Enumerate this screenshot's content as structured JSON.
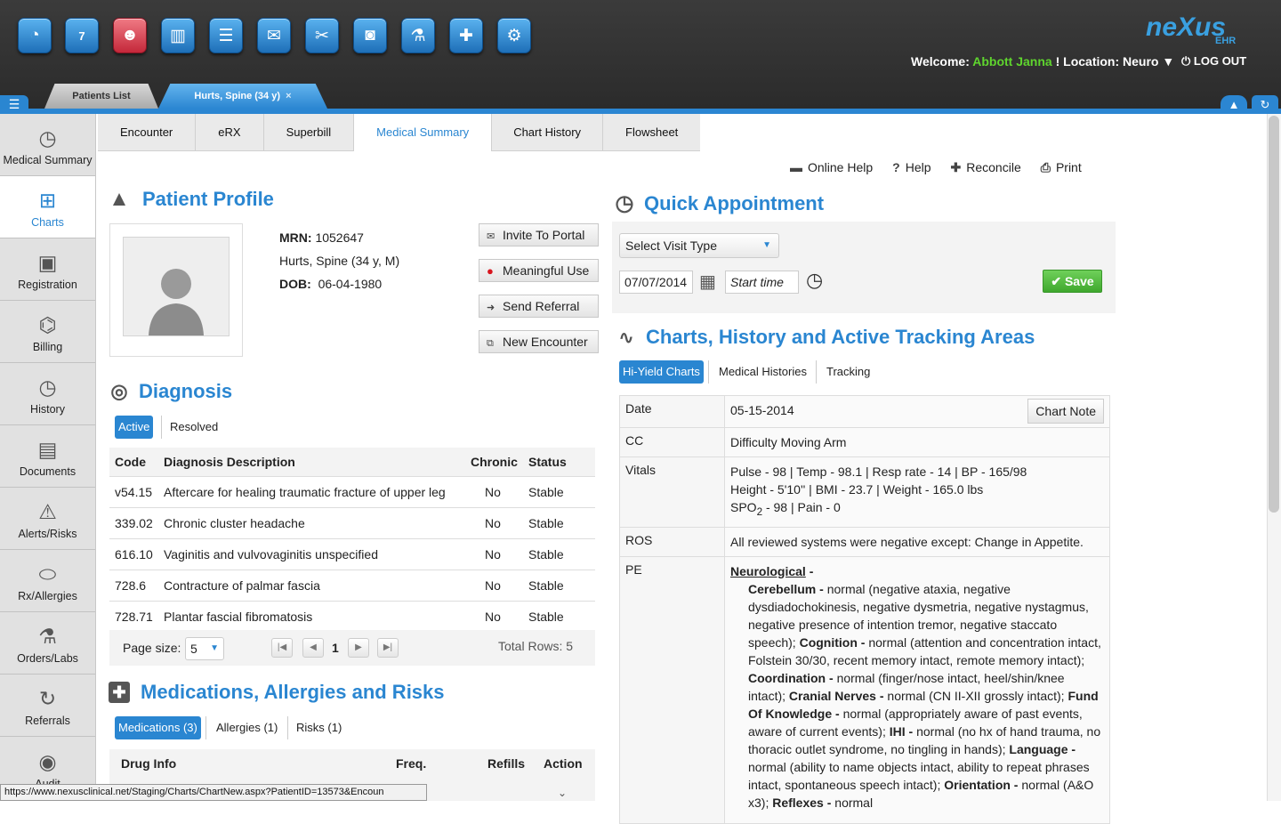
{
  "top_icons": [
    "dashboard-icon",
    "calendar-icon",
    "patients-icon",
    "reports-icon",
    "notes-icon",
    "mail-icon",
    "tools-icon",
    "camera-icon",
    "lab-flask-icon",
    "bandage-icon",
    "settings-icon"
  ],
  "calendar_day": "7",
  "logo": {
    "text1": "neXus",
    "text2": "EHR"
  },
  "header": {
    "welcome_label": "Welcome:",
    "user_name": "Abbott Janna",
    "location_label": "! Location: Neuro",
    "logout": "LOG OUT"
  },
  "patient_tabs": {
    "list": "Patients List",
    "active": "Hurts, Spine (34 y)",
    "close": "×"
  },
  "sidebar": [
    {
      "label": "Medical Summary",
      "icon": "clock-icon"
    },
    {
      "label": "Charts",
      "icon": "medkit-icon"
    },
    {
      "label": "Registration",
      "icon": "id-card-icon"
    },
    {
      "label": "Billing",
      "icon": "tag-icon"
    },
    {
      "label": "History",
      "icon": "clock-icon"
    },
    {
      "label": "Documents",
      "icon": "cabinet-icon"
    },
    {
      "label": "Alerts/Risks",
      "icon": "warning-icon"
    },
    {
      "label": "Rx/Allergies",
      "icon": "pill-icon"
    },
    {
      "label": "Orders/Labs",
      "icon": "flask-icon"
    },
    {
      "label": "Referrals",
      "icon": "refresh-icon"
    },
    {
      "label": "Audit",
      "icon": "eye-icon"
    }
  ],
  "nav_tabs": [
    "Encounter",
    "eRX",
    "Superbill",
    "Medical Summary",
    "Chart History",
    "Flowsheet"
  ],
  "toolbar": {
    "online_help": "Online Help",
    "help": "Help",
    "reconcile": "Reconcile",
    "print": "Print"
  },
  "profile": {
    "title": "Patient Profile",
    "mrn_label": "MRN:",
    "mrn": "1052647",
    "name": "Hurts, Spine (34 y, M)",
    "dob_label": "DOB:",
    "dob": "06-04-1980"
  },
  "actions": [
    "Invite To Portal",
    "Meaningful Use",
    "Send Referral",
    "New Encounter"
  ],
  "diagnosis": {
    "title": "Diagnosis",
    "tab_active": "Active",
    "tab_resolved": "Resolved",
    "headers": [
      "Code",
      "Diagnosis Description",
      "Chronic",
      "Status"
    ],
    "rows": [
      [
        "v54.15",
        "Aftercare for healing traumatic fracture of upper leg",
        "No",
        "Stable"
      ],
      [
        "339.02",
        "Chronic cluster headache",
        "No",
        "Stable"
      ],
      [
        "616.10",
        "Vaginitis and vulvovaginitis unspecified",
        "No",
        "Stable"
      ],
      [
        "728.6",
        "Contracture of palmar fascia",
        "No",
        "Stable"
      ],
      [
        "728.71",
        "Plantar fascial fibromatosis",
        "No",
        "Stable"
      ]
    ],
    "page_size_label": "Page size:",
    "page_size": "5",
    "page": "1",
    "total_rows": "Total Rows: 5"
  },
  "meds": {
    "title": "Medications, Allergies and Risks",
    "tabs": [
      "Medications (3)",
      "Allergies (1)",
      "Risks (1)"
    ],
    "headers": [
      "Drug Info",
      "Freq.",
      "Refills",
      "Action"
    ]
  },
  "appt": {
    "title": "Quick Appointment",
    "visit_type": "Select Visit Type",
    "date": "07/07/2014",
    "start_placeholder": "Start time",
    "save": "Save"
  },
  "charts": {
    "title": "Charts, History and Active Tracking Areas",
    "tabs": [
      "Hi-Yield Charts",
      "Medical Histories",
      "Tracking"
    ],
    "date_label": "Date",
    "date": "05-15-2014",
    "chart_note": "Chart Note",
    "cc_label": "CC",
    "cc": "Difficulty Moving Arm",
    "vitals_label": "Vitals",
    "vitals1": "Pulse - 98 | Temp - 98.1 | Resp rate - 14 | BP - 165/98",
    "vitals2": "Height - 5'10'' | BMI - 23.7 | Weight - 165.0 lbs",
    "vitals3a": "SPO",
    "vitals3sub": "2",
    "vitals3b": " - 98 | Pain - 0",
    "ros_label": "ROS",
    "ros": "All reviewed systems were negative except: Change in Appetite.",
    "pe_label": "PE",
    "pe_heading": "Neurological",
    "pe_items": [
      {
        "k": "Cerebellum",
        "v": "normal (negative ataxia, negative dysdiadochokinesis, negative dysmetria, negative nystagmus, negative presence of intention tremor, negative staccato speech);"
      },
      {
        "k": "Cognition",
        "v": "normal (attention and concentration intact, Folstein 30/30, recent memory intact, remote memory intact);"
      },
      {
        "k": "Coordination",
        "v": "normal (finger/nose intact, heel/shin/knee intact);"
      },
      {
        "k": "Cranial Nerves",
        "v": "normal (CN II-XII grossly intact);"
      },
      {
        "k": "Fund Of Knowledge",
        "v": "normal (appropriately aware of past events, aware of current events);"
      },
      {
        "k": "IHI",
        "v": "normal (no hx of hand trauma, no thoracic outlet syndrome, no tingling in hands);"
      },
      {
        "k": "Language",
        "v": "normal (ability to name objects intact, ability to repeat phrases intact, spontaneous speech intact);"
      },
      {
        "k": "Orientation",
        "v": "normal (A&O x3);"
      },
      {
        "k": "Reflexes",
        "v": "normal"
      }
    ]
  },
  "status_url": "https://www.nexusclinical.net/Staging/Charts/ChartNew.aspx?PatientID=13573&Encoun"
}
